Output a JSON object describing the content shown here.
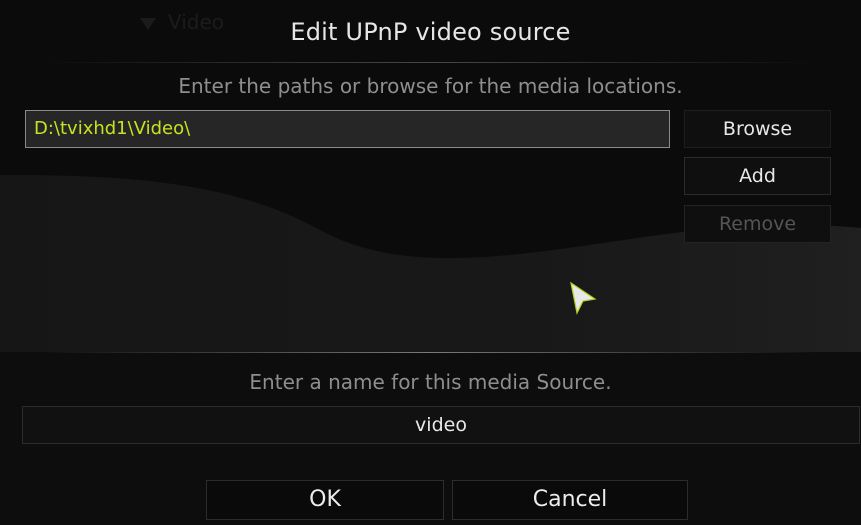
{
  "background": {
    "ghost_menu_label": "Video"
  },
  "dialog": {
    "title": "Edit UPnP video source",
    "paths_hint": "Enter the paths or browse for the media locations.",
    "paths": [
      {
        "value": "D:\\tvixhd1\\Video\\"
      }
    ],
    "buttons": {
      "browse": "Browse",
      "add": "Add",
      "remove": "Remove"
    },
    "name_hint": "Enter a name for this media Source.",
    "name_value": "video",
    "ok": "OK",
    "cancel": "Cancel"
  },
  "colors": {
    "selected_path_text": "#c9e21d",
    "disabled_text": "#555555"
  },
  "icons": {
    "cursor": "mouse-pointer-icon"
  }
}
